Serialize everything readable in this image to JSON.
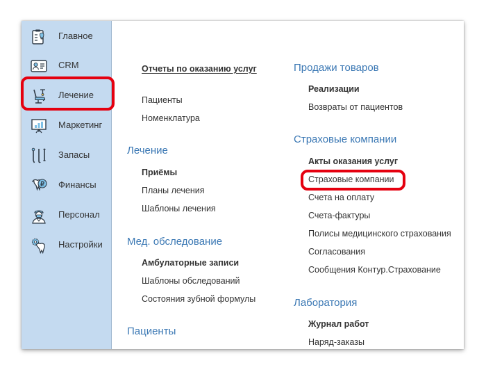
{
  "sidebar": {
    "items": [
      {
        "label": "Главное",
        "icon": "clipboard-tooth-icon"
      },
      {
        "label": "CRM",
        "icon": "id-card-icon"
      },
      {
        "label": "Лечение",
        "icon": "dental-chair-icon"
      },
      {
        "label": "Маркетинг",
        "icon": "presentation-chart-icon"
      },
      {
        "label": "Запасы",
        "icon": "dental-tools-icon"
      },
      {
        "label": "Финансы",
        "icon": "tooth-ruble-icon"
      },
      {
        "label": "Персонал",
        "icon": "doctor-icon"
      },
      {
        "label": "Настройки",
        "icon": "tooth-gear-icon"
      }
    ],
    "active_index": 2
  },
  "left_col": {
    "top_links": [
      "Отчеты по оказанию услуг",
      "Пациенты",
      "Номенклатура"
    ],
    "treatment": {
      "title": "Лечение",
      "links": [
        "Приёмы",
        "Планы лечения",
        "Шаблоны лечения"
      ]
    },
    "exam": {
      "title": "Мед. обследование",
      "links": [
        "Амбулаторные записи",
        "Шаблоны обследований",
        "Состояния зубной формулы"
      ]
    },
    "patients": {
      "title": "Пациенты"
    }
  },
  "right_col": {
    "sales": {
      "title": "Продажи товаров",
      "links": [
        "Реализации",
        "Возвраты от пациентов"
      ]
    },
    "insurance": {
      "title": "Страховые компании",
      "links": [
        "Акты оказания услуг",
        "Страховые компании",
        "Счета на оплату",
        "Счета-фактуры",
        "Полисы медицинского страхования",
        "Согласования",
        "Сообщения Контур.Страхование"
      ]
    },
    "lab": {
      "title": "Лаборатория",
      "links": [
        "Журнал работ",
        "Наряд-заказы"
      ]
    }
  },
  "colors": {
    "sidebar_bg": "#c4daf0",
    "section_title": "#3b78b4",
    "highlight": "#e5000f"
  }
}
